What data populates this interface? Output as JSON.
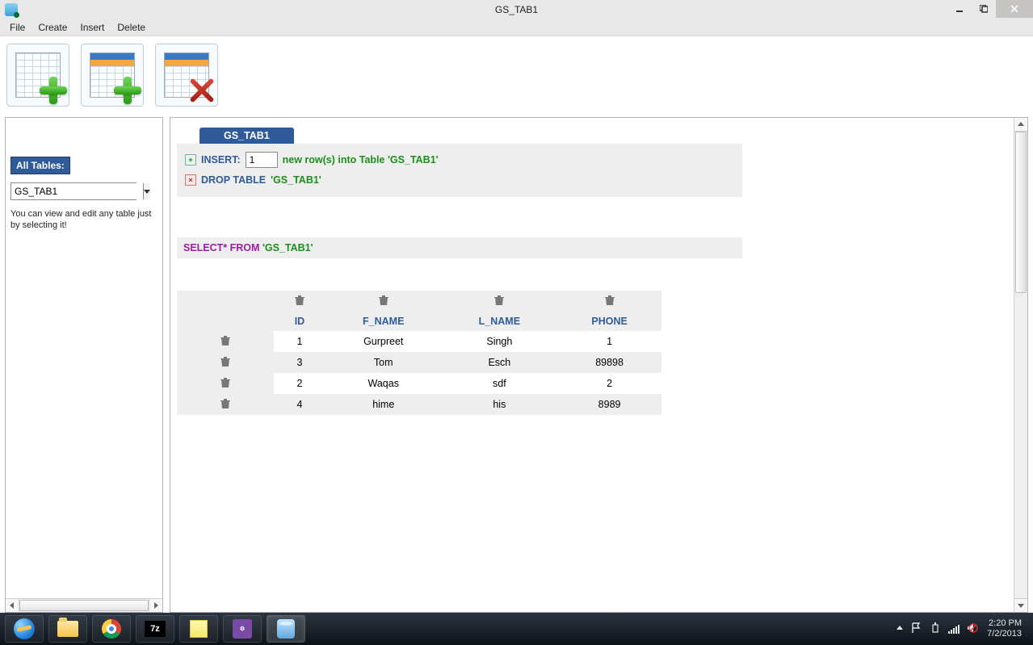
{
  "window": {
    "title": "GS_TAB1"
  },
  "menu": {
    "file": "File",
    "create": "Create",
    "insert": "Insert",
    "delete": "Delete"
  },
  "sidebar": {
    "header": "All Tables:",
    "selected": "GS_TAB1",
    "hint": "You can view and edit any table just by selecting it!"
  },
  "actions": {
    "tab_label": "GS_TAB1",
    "insert_label": "INSERT:",
    "insert_value": "1",
    "insert_suffix": "new row(s) into Table 'GS_TAB1'",
    "drop_label": "DROP TABLE",
    "drop_table": "'GS_TAB1'"
  },
  "select": {
    "keyword": "SELECT* FROM",
    "table": "'GS_TAB1'"
  },
  "table": {
    "columns": [
      "ID",
      "F_NAME",
      "L_NAME",
      "PHONE"
    ],
    "rows": [
      {
        "ID": "1",
        "F_NAME": "Gurpreet",
        "L_NAME": "Singh",
        "PHONE": "1"
      },
      {
        "ID": "3",
        "F_NAME": "Tom",
        "L_NAME": "Esch",
        "PHONE": "89898"
      },
      {
        "ID": "2",
        "F_NAME": "Waqas",
        "L_NAME": "sdf",
        "PHONE": "2"
      },
      {
        "ID": "4",
        "F_NAME": "hime",
        "L_NAME": "his",
        "PHONE": "8989"
      }
    ]
  },
  "taskbar": {
    "sevenz": "7z",
    "javaee": "Java EE IDE",
    "time": "2:20 PM",
    "date": "7/2/2013"
  }
}
